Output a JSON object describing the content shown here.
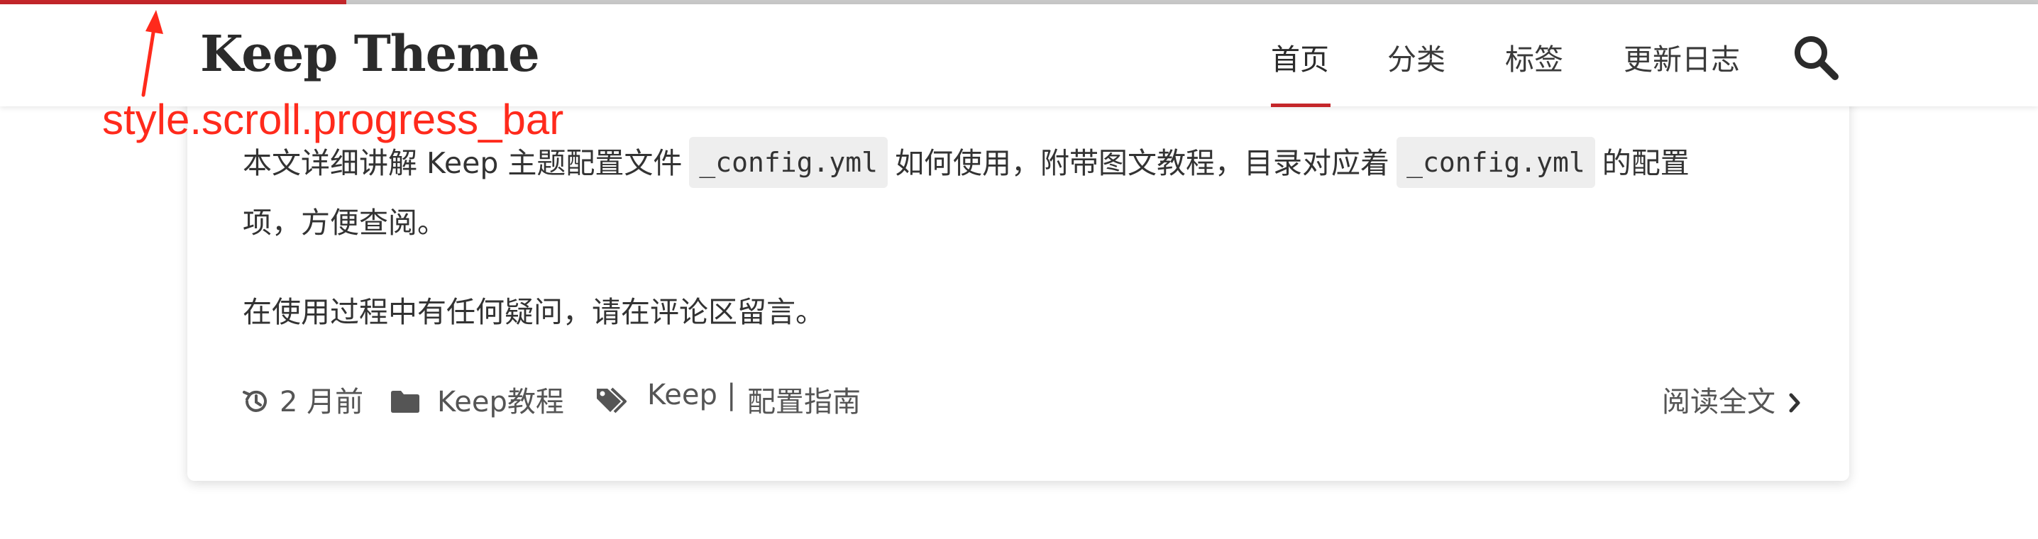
{
  "scroll": {
    "progress_fraction": 0.17
  },
  "header": {
    "logo": "Keep Theme",
    "nav": [
      "首页",
      "分类",
      "标签",
      "更新日志"
    ],
    "active_nav": "首页"
  },
  "annotation": {
    "label": "style.scroll.progress_bar",
    "color": "#ff2a1c"
  },
  "post": {
    "intro_before": "本文详细讲解 Keep 主题配置文件",
    "code1": "_config.yml",
    "intro_middle": "如何使用，附带图文教程，目录对应着",
    "code2": "_config.yml",
    "intro_after": "的配置",
    "intro_line2": "项，方便查阅。",
    "para2": "在使用过程中有任何疑问，请在评论区留言。",
    "meta": {
      "time": "2 月前",
      "category": "Keep教程",
      "tag1": "Keep",
      "separator": "|",
      "tag2": "配置指南"
    },
    "read_more": "阅读全文"
  },
  "colors": {
    "accent": "#c4262a",
    "track": "#c9c9c9"
  },
  "icons": {
    "search": "search-icon",
    "time": "history-icon",
    "category": "folder-icon",
    "tags": "tags-icon",
    "read_more": "chevron-right-icon"
  }
}
